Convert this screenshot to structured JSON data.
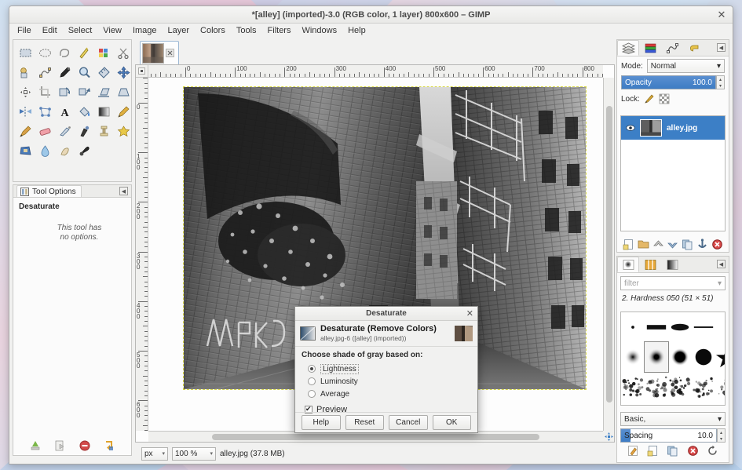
{
  "window": {
    "title": "*[alley] (imported)-3.0 (RGB color, 1 layer) 800x600 – GIMP",
    "close_label": "✕"
  },
  "menubar": {
    "items": [
      "File",
      "Edit",
      "Select",
      "View",
      "Image",
      "Layer",
      "Colors",
      "Tools",
      "Filters",
      "Windows",
      "Help"
    ]
  },
  "toolbox": {
    "tools": [
      "rect-select-tool",
      "ellipse-select-tool",
      "free-select-tool",
      "fuzzy-select-tool",
      "select-by-color-tool",
      "scissors-select-tool",
      "foreground-select-tool",
      "paths-tool",
      "color-picker-tool",
      "zoom-tool",
      "measure-tool",
      "move-tool",
      "alignment-tool",
      "crop-tool",
      "rotate-tool",
      "scale-tool",
      "shear-tool",
      "perspective-tool",
      "flip-tool",
      "cage-transform-tool",
      "text-tool",
      "bucket-fill-tool",
      "gradient-tool",
      "pencil-tool",
      "paintbrush-tool",
      "eraser-tool",
      "airbrush-tool",
      "ink-tool",
      "clone-tool",
      "heal-tool",
      "perspective-clone-tool",
      "blur-sharpen-tool",
      "smudge-tool",
      "dodge-burn-tool"
    ],
    "foreground_color": "#000000",
    "background_color": "#ffffff"
  },
  "tool_options": {
    "tab_label": "Tool Options",
    "active_tool": "Desaturate",
    "note": "This tool has\nno options.",
    "buttons": [
      "save-tool-preset-button",
      "restore-tool-preset-button",
      "delete-tool-preset-button",
      "reset-tool-options-button"
    ]
  },
  "canvas": {
    "tab_name": "alley",
    "image_filename": "alley.jpg",
    "ruler_unit_labels_h": [
      "0",
      "100",
      "200",
      "300",
      "400",
      "500",
      "600",
      "700",
      "800"
    ],
    "ruler_unit_labels_v": [
      "0",
      "100",
      "200",
      "300",
      "400",
      "500",
      "600"
    ]
  },
  "statusbar": {
    "unit": "px",
    "zoom": "100 %",
    "file_info": "alley.jpg (37.8 MB)"
  },
  "layers_dock": {
    "tabs": [
      "layers-tab",
      "channels-tab",
      "paths-tab",
      "undo-history-tab"
    ],
    "mode_label": "Mode:",
    "mode_value": "Normal",
    "opacity_label": "Opacity",
    "opacity_value": "100.0",
    "lock_label": "Lock:",
    "layers": [
      {
        "name": "alley.jpg",
        "visible": true,
        "selected": true
      }
    ],
    "buttons": [
      "new-layer-button",
      "new-layer-group-button",
      "raise-layer-button",
      "lower-layer-button",
      "duplicate-layer-button",
      "anchor-layer-button",
      "delete-layer-button"
    ]
  },
  "brushes_dock": {
    "tabs": [
      "brushes-tab",
      "patterns-tab",
      "gradients-tab"
    ],
    "filter_placeholder": "filter",
    "selected_brush": "2. Hardness 050 (51 × 51)",
    "tag_filter_value": "Basic,",
    "spacing_label": "Spacing",
    "spacing_value": "10.0",
    "buttons": [
      "edit-brush-button",
      "new-brush-button",
      "duplicate-brush-button",
      "delete-brush-button",
      "refresh-brushes-button"
    ]
  },
  "dialog": {
    "title": "Desaturate",
    "close_label": "✕",
    "heading": "Desaturate (Remove Colors)",
    "subheading": "alley.jpg-6 ([alley] (imported))",
    "prompt": "Choose shade of gray based on:",
    "options": [
      {
        "label": "Lightness",
        "selected": true
      },
      {
        "label": "Luminosity",
        "selected": false
      },
      {
        "label": "Average",
        "selected": false
      }
    ],
    "preview_label": "Preview",
    "preview_checked": true,
    "buttons": [
      "Help",
      "Reset",
      "Cancel",
      "OK"
    ]
  },
  "colors": {
    "accent": "#3c7fc6",
    "window_bg": "#f1f1f0",
    "panel_bg": "#fbfbfb",
    "selection_dash": "#d8d84a"
  }
}
